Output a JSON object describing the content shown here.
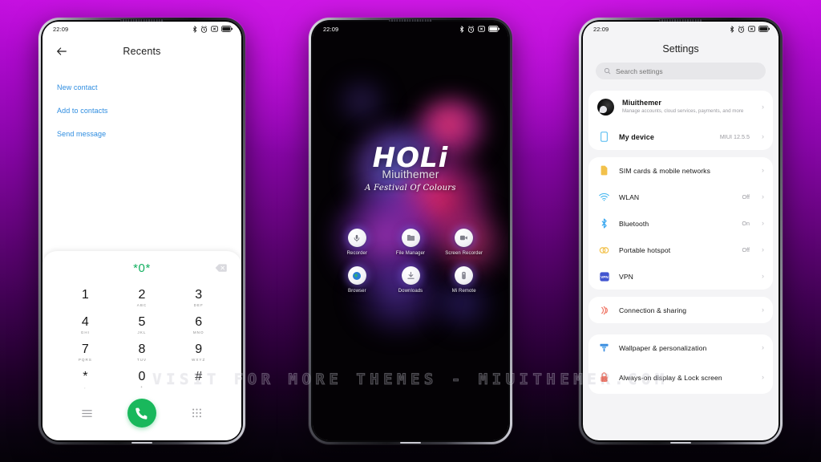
{
  "watermark": "VISIT FOR MORE THEMES - MIUITHEMER.COM",
  "background": {
    "top_color": "#c40fe0",
    "bottom_color": "#050208"
  },
  "statusbar": {
    "time": "22:09",
    "icons": [
      "bluetooth-icon",
      "alarm-icon",
      "silent-icon",
      "battery-icon"
    ]
  },
  "phone1": {
    "app": "Dialer",
    "statusbar_time": "22:09",
    "appbar": {
      "back_label": "back-arrow",
      "title": "Recents"
    },
    "actions": [
      {
        "label": "New contact"
      },
      {
        "label": "Add to contacts"
      },
      {
        "label": "Send message"
      }
    ],
    "dialpad": {
      "entry": "*0*",
      "entry_color": "#13b060",
      "backspace": "backspace-icon",
      "keys": [
        {
          "digit": "1",
          "letters": ""
        },
        {
          "digit": "2",
          "letters": "ABC"
        },
        {
          "digit": "3",
          "letters": "DEF"
        },
        {
          "digit": "4",
          "letters": "GHI"
        },
        {
          "digit": "5",
          "letters": "JKL"
        },
        {
          "digit": "6",
          "letters": "MNO"
        },
        {
          "digit": "7",
          "letters": "PQRS"
        },
        {
          "digit": "8",
          "letters": "TUV"
        },
        {
          "digit": "9",
          "letters": "WXYZ"
        },
        {
          "digit": "*",
          "letters": ","
        },
        {
          "digit": "0",
          "letters": "+"
        },
        {
          "digit": "#",
          "letters": ""
        }
      ],
      "menu_icon": "menu-icon",
      "call_icon": "call-icon",
      "keypad_icon": "keypad-icon",
      "call_button_color": "#19b85c"
    }
  },
  "phone2": {
    "app": "Home screen",
    "statusbar_time": "22:09",
    "wallpaper": {
      "title": "HOLi",
      "brand": "Miuithemer",
      "subtitle": "A Festival Of Colours"
    },
    "apps": [
      {
        "label": "Recorder",
        "icon": "recorder-icon"
      },
      {
        "label": "File Manager",
        "icon": "file-manager-icon"
      },
      {
        "label": "Screen Recorder",
        "icon": "screen-recorder-icon"
      },
      {
        "label": "Browser",
        "icon": "browser-icon"
      },
      {
        "label": "Downloads",
        "icon": "downloads-icon"
      },
      {
        "label": "Mi Remote",
        "icon": "mi-remote-icon"
      }
    ]
  },
  "phone3": {
    "app": "Settings",
    "statusbar_time": "22:09",
    "title": "Settings",
    "search": {
      "placeholder": "Search settings",
      "icon": "search-icon"
    },
    "account": {
      "name": "Miuithemer",
      "subtitle": "Manage accounts, cloud services, payments, and more",
      "avatar": "avatar"
    },
    "device": {
      "label": "My device",
      "value": "MIUI 12.5.5",
      "icon": "device-icon",
      "color": "#4fb9f0"
    },
    "items": [
      {
        "label": "SIM cards & mobile networks",
        "value": "",
        "icon": "sim-icon",
        "color": "#f2c14b"
      },
      {
        "label": "WLAN",
        "value": "Off",
        "icon": "wifi-icon",
        "color": "#4cb9f0"
      },
      {
        "label": "Bluetooth",
        "value": "On",
        "icon": "bluetooth-icon",
        "color": "#3aa8f0"
      },
      {
        "label": "Portable hotspot",
        "value": "Off",
        "icon": "hotspot-icon",
        "color": "#f2c14b"
      },
      {
        "label": "VPN",
        "value": "",
        "icon": "vpn-icon",
        "color": "#4255d0"
      }
    ],
    "items2": [
      {
        "label": "Connection & sharing",
        "value": "",
        "icon": "connection-sharing-icon",
        "color": "#ef6f5e"
      }
    ],
    "items3": [
      {
        "label": "Wallpaper & personalization",
        "value": "",
        "icon": "wallpaper-icon",
        "color": "#3d8fe0"
      },
      {
        "label": "Always-on display & Lock screen",
        "value": "",
        "icon": "lock-icon",
        "color": "#f2604b"
      }
    ],
    "chevron": "›"
  }
}
